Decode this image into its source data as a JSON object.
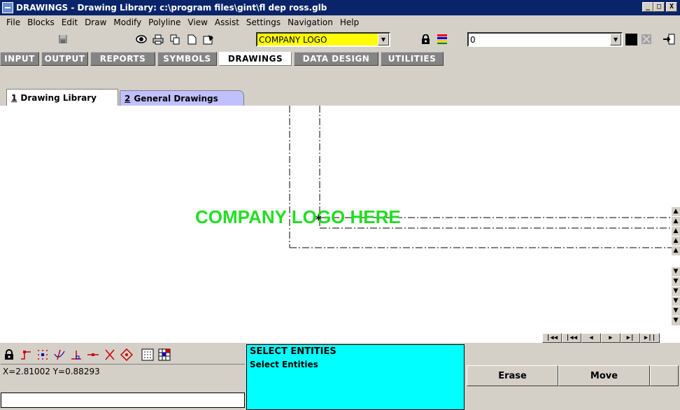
{
  "titlebar": {
    "title": "DRAWINGS - Drawing Library:  c:\\program files\\gint\\fl dep ross.glb",
    "min": "_",
    "max": "□",
    "close": "X"
  },
  "menu": [
    "File",
    "Blocks",
    "Edit",
    "Draw",
    "Modify",
    "Polyline",
    "View",
    "Assist",
    "Settings",
    "Navigation",
    "Help"
  ],
  "toolbar": {
    "block_combo_value": "COMPANY LOGO",
    "layer_combo_value": "0",
    "color_swatch": "#000000"
  },
  "main_tabs": [
    "INPUT",
    "OUTPUT",
    "REPORTS",
    "SYMBOLS",
    "DRAWINGS",
    "DATA DESIGN",
    "UTILITIES"
  ],
  "active_main_tab": "DRAWINGS",
  "sub_tabs": [
    {
      "num": "1",
      "label": "Drawing Library",
      "active": true
    },
    {
      "num": "2",
      "label": "General Drawings",
      "active": false
    }
  ],
  "canvas": {
    "placeholder_text": "COMPANY LOGO HERE",
    "placeholder_color": "#22dd22",
    "insertion_marker": "*"
  },
  "record_nav": [
    "|◀◀",
    "|◀◀",
    "◀",
    "▶",
    "▶|",
    "▶||"
  ],
  "status": {
    "coords": "X=2.81002  Y=0.88293",
    "prompt_title": "SELECT ENTITIES",
    "prompt_text": "Select Entities"
  },
  "command_buttons": [
    "Erase",
    "Move"
  ],
  "colors": {
    "title_bar": "#0a246a",
    "tab_gray": "#848484",
    "subtab_inactive": "#c0c0ff",
    "prompt_bg": "#00ffff",
    "combo_highlight": "#ffff00"
  }
}
